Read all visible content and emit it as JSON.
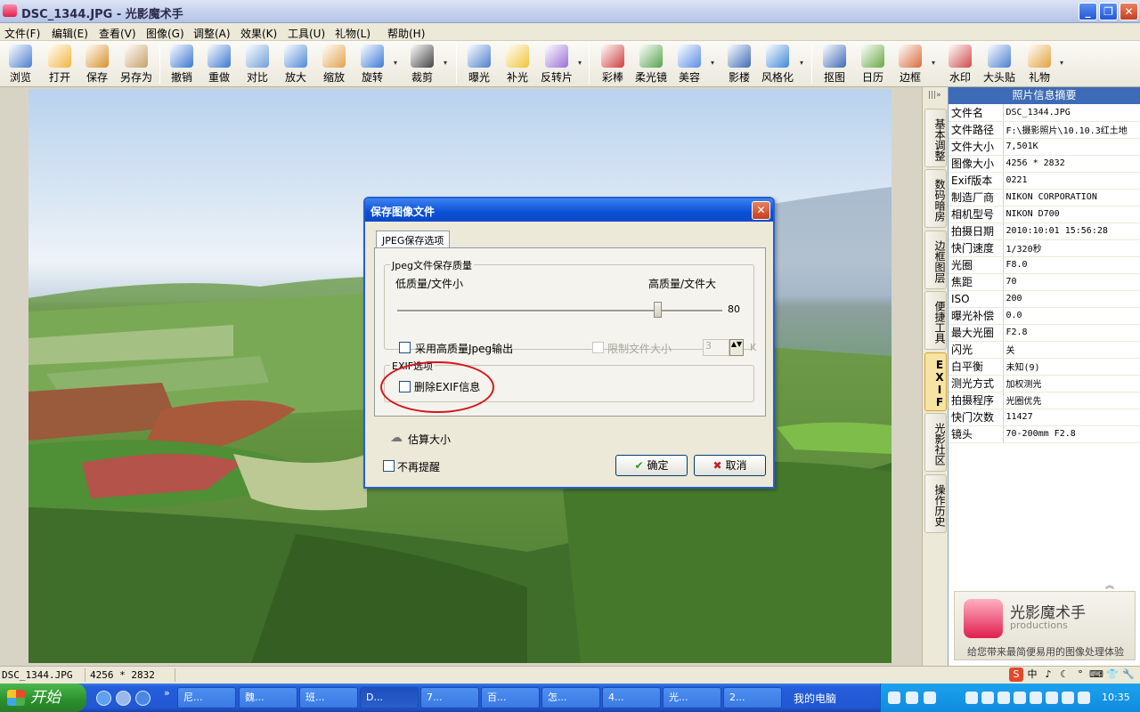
{
  "window": {
    "title": "DSC_1344.JPG - 光影魔术手",
    "min_glyph": "_",
    "max_glyph": "❐",
    "close_glyph": "✕"
  },
  "menu": [
    "文件(F)",
    "编辑(E)",
    "查看(V)",
    "图像(G)",
    "调整(A)",
    "效果(K)",
    "工具(U)",
    "礼物(L)",
    "帮助(H)"
  ],
  "toolbar": [
    {
      "label": "浏览",
      "icon": "eye-icon",
      "color": "#4a7fcf"
    },
    {
      "label": "打开",
      "icon": "folder-open-icon",
      "color": "#f2b640"
    },
    {
      "label": "保存",
      "icon": "save-icon",
      "color": "#d9902a"
    },
    {
      "label": "另存为",
      "icon": "save-as-icon",
      "color": "#c8a065"
    },
    {
      "label": "撤销",
      "icon": "undo-icon",
      "color": "#3a78d0"
    },
    {
      "label": "重做",
      "icon": "redo-icon",
      "color": "#3a78d0"
    },
    {
      "label": "对比",
      "icon": "compare-icon",
      "color": "#6ea0d8"
    },
    {
      "label": "放大",
      "icon": "zoom-in-icon",
      "color": "#4c8ad6"
    },
    {
      "label": "缩放",
      "icon": "resize-icon",
      "color": "#e3a24a"
    },
    {
      "label": "旋转",
      "icon": "rotate-icon",
      "color": "#3a7cd6"
    },
    {
      "label": "裁剪",
      "icon": "crop-icon",
      "color": "#444444"
    },
    {
      "label": "曝光",
      "icon": "exposure-icon",
      "color": "#4a7fcf"
    },
    {
      "label": "补光",
      "icon": "fill-light-icon",
      "color": "#f0c437"
    },
    {
      "label": "反转片",
      "icon": "reversal-film-icon",
      "color": "#9c6ed8"
    },
    {
      "label": "彩棒",
      "icon": "color-wand-icon",
      "color": "#cf3d3d"
    },
    {
      "label": "柔光镜",
      "icon": "soft-focus-icon",
      "color": "#56a34a"
    },
    {
      "label": "美容",
      "icon": "beauty-icon",
      "color": "#5a8ee6"
    },
    {
      "label": "影楼",
      "icon": "studio-icon",
      "color": "#3d6bb5"
    },
    {
      "label": "风格化",
      "icon": "stylize-icon",
      "color": "#3d8ad6"
    },
    {
      "label": "抠图",
      "icon": "cutout-icon",
      "color": "#3d6bb5"
    },
    {
      "label": "日历",
      "icon": "calendar-icon",
      "color": "#6aa843"
    },
    {
      "label": "边框",
      "icon": "border-icon",
      "color": "#d96b3c"
    },
    {
      "label": "水印",
      "icon": "watermark-icon",
      "color": "#d04a4a"
    },
    {
      "label": "大头贴",
      "icon": "sticker-icon",
      "color": "#4a7fcf"
    },
    {
      "label": "礼物",
      "icon": "gift-icon",
      "color": "#e3a23a"
    }
  ],
  "toolbar_arrow_glyph": "▾",
  "side_tabs": [
    "基本调整",
    "数码暗房",
    "边框图层",
    "便捷工具",
    "EXIF",
    "光影社区",
    "操作历史"
  ],
  "side_tabs_expand": "|||»",
  "panel": {
    "title": "照片信息摘要",
    "rows": [
      {
        "k": "文件名",
        "v": "DSC_1344.JPG"
      },
      {
        "k": "文件路径",
        "v": "F:\\摄影照片\\10.10.3红土地"
      },
      {
        "k": "文件大小",
        "v": "7,501K"
      },
      {
        "k": "图像大小",
        "v": "4256 * 2832"
      },
      {
        "k": "Exif版本",
        "v": "0221"
      },
      {
        "k": "制造厂商",
        "v": "NIKON CORPORATION"
      },
      {
        "k": "相机型号",
        "v": "NIKON D700"
      },
      {
        "k": "拍摄日期",
        "v": "2010:10:01 15:56:28"
      },
      {
        "k": "快门速度",
        "v": "1/320秒"
      },
      {
        "k": "光圈",
        "v": "F8.0"
      },
      {
        "k": "焦距",
        "v": "70"
      },
      {
        "k": "ISO",
        "v": "200"
      },
      {
        "k": "曝光补偿",
        "v": "0.0"
      },
      {
        "k": "最大光圈",
        "v": "F2.8"
      },
      {
        "k": "闪光",
        "v": "关"
      },
      {
        "k": "白平衡",
        "v": "未知(9)"
      },
      {
        "k": "测光方式",
        "v": "加权测光"
      },
      {
        "k": "拍摄程序",
        "v": "光圈优先"
      },
      {
        "k": "快门次数",
        "v": "11427"
      },
      {
        "k": "镜头",
        "v": "70-200mm F2.8"
      }
    ],
    "collapse_glyph": "︽",
    "promo_name": "光影魔术手",
    "promo_sub": "productions",
    "promo_slogan": "给您带来最简便易用的图像处理体验"
  },
  "dialog": {
    "title": "保存图像文件",
    "close_glyph": "✕",
    "tab": "JPEG保存选项",
    "quality_group": "Jpeg文件保存质量",
    "low_label": "低质量/文件小",
    "high_label": "高质量/文件大",
    "quality_value": "80",
    "quality_fraction": 0.8,
    "hq_checkbox": "采用高质量Jpeg输出",
    "limit_checkbox": "限制文件大小",
    "limit_value": "3",
    "limit_unit": "K",
    "exif_group": "EXIF选项",
    "exif_checkbox": "删除EXIF信息",
    "estimate": "估算大小",
    "no_remind": "不再提醒",
    "ok": "确定",
    "cancel": "取消",
    "ok_glyph": "✔",
    "cancel_glyph": "✖"
  },
  "status": {
    "filename": "DSC_1344.JPG",
    "size": "4256 * 2832"
  },
  "ime": [
    "S",
    "中",
    "♪",
    "☾",
    "°",
    "⌨",
    "👕",
    "🔧"
  ],
  "taskbar": {
    "start": "开始",
    "buttons": [
      "尼...",
      "魏...",
      "班...",
      "D...",
      "7...",
      "百...",
      "怎...",
      "4...",
      "光...",
      "2..."
    ],
    "more": "»",
    "mycomputer": "我的电脑",
    "clock": "10:35"
  }
}
